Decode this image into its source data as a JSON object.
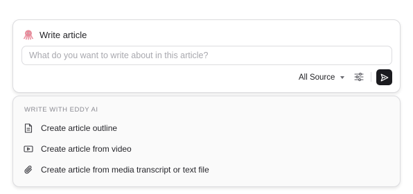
{
  "composer": {
    "title": "Write article",
    "logo_icon": "octopus-icon",
    "input": {
      "value": "",
      "placeholder": "What do you want to write about in this article?"
    },
    "source": {
      "label": "All Source",
      "icon": "chevron-down-icon"
    },
    "filter_icon": "sliders-icon",
    "send_icon": "send-icon",
    "colors": {
      "send_button": "#1b1b1f",
      "logo": "#e88a9a"
    }
  },
  "menu": {
    "heading": "WRITE WITH EDDY AI",
    "items": [
      {
        "label": "Create article outline",
        "icon": "document-icon"
      },
      {
        "label": "Create article from video",
        "icon": "video-icon"
      },
      {
        "label": "Create article from media transcript or text file",
        "icon": "paperclip-icon"
      }
    ]
  }
}
